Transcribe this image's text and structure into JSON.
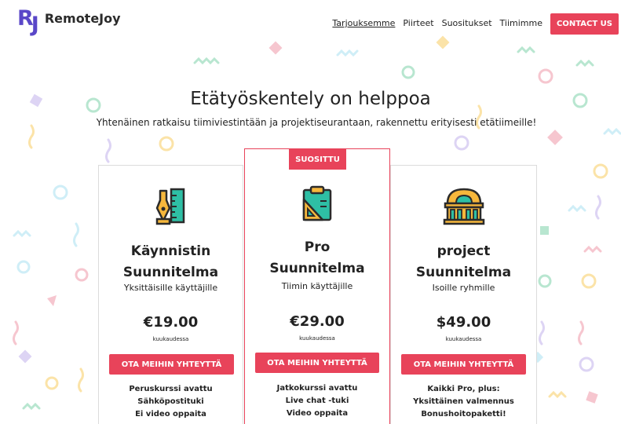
{
  "brand": {
    "mark": "RJ",
    "mark_r": "R",
    "mark_j": "J",
    "name": "RemoteJoy"
  },
  "nav": {
    "items": [
      "Tarjouksemme",
      "Piirteet",
      "Suositukset",
      "Tiimimme"
    ],
    "active": "Tarjouksemme",
    "contact_label": "CONTACT US"
  },
  "hero": {
    "title": "Etätyöskentely on helppoa",
    "subtitle": "Yhtenäinen ratkaisu tiimiviestintään ja projektiseurantaan, rakennettu erityisesti etätiimeille!"
  },
  "plans": [
    {
      "icon": "pen-ruler-icon",
      "name_line1": "Käynnistin",
      "name_line2": "Suunnitelma",
      "audience": "Yksittäisille käyttäjille",
      "price": "€19.00",
      "period": "kuukaudessa",
      "button": "OTA MEIHIN YHTEYTTÄ",
      "features": [
        "Peruskurssi avattu",
        "Sähköpostituki",
        "Ei video oppaita"
      ]
    },
    {
      "badge": "SUOSITTU",
      "icon": "clipboard-icon",
      "name_line1": "Pro",
      "name_line2": "Suunnitelma",
      "audience": "Tiimin käyttäjille",
      "price": "€29.00",
      "period": "kuukaudessa",
      "button": "OTA MEIHIN YHTEYTTÄ",
      "features": [
        "Jatkokurssi avattu",
        "Live chat -tuki",
        "Video oppaita"
      ]
    },
    {
      "icon": "building-icon",
      "name_line1": "project",
      "name_line2": "Suunnitelma",
      "audience": "Isoille ryhmille",
      "price": "$49.00",
      "period": "kuukaudessa",
      "button": "OTA MEIHIN YHTEYTTÄ",
      "features": [
        "Kaikki Pro, plus:",
        "Yksittäinen valmennus",
        "Bonushoitopaketti!"
      ]
    }
  ],
  "colors": {
    "accent": "#e8435a",
    "brand": "#5a47c8",
    "text": "#222222",
    "card_border": "#dcdcdc"
  }
}
